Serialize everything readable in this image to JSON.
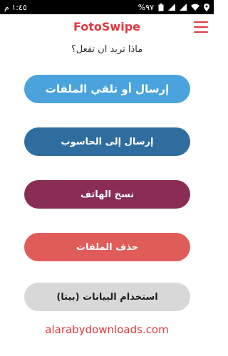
{
  "status_bar": {
    "time": "١:٤٥ م",
    "battery": "%٩٧",
    "icons": [
      "battery-icon",
      "signal-icon",
      "signal-icon-2",
      "wifi-icon",
      "location-icon"
    ]
  },
  "header": {
    "title": "FotoSwipe",
    "menu_icon": "hamburger-menu-icon",
    "accent_color": "#e1373f"
  },
  "prompt": "ماذا تريد ان تفعل؟",
  "actions": [
    {
      "label": "إرسال أو تلقي الملفات",
      "color": "#4aa3dd"
    },
    {
      "label": "إرسال إلى الحاسوب",
      "color": "#2f6d9f"
    },
    {
      "label": "نسخ الهاتف",
      "color": "#8a2d55"
    },
    {
      "label": "حذف الملفات",
      "color": "#e05c59"
    },
    {
      "label": "استخدام البيانات (بيتا)",
      "color": "#d8d8d8"
    }
  ],
  "watermark": "alarabydownloads.com"
}
